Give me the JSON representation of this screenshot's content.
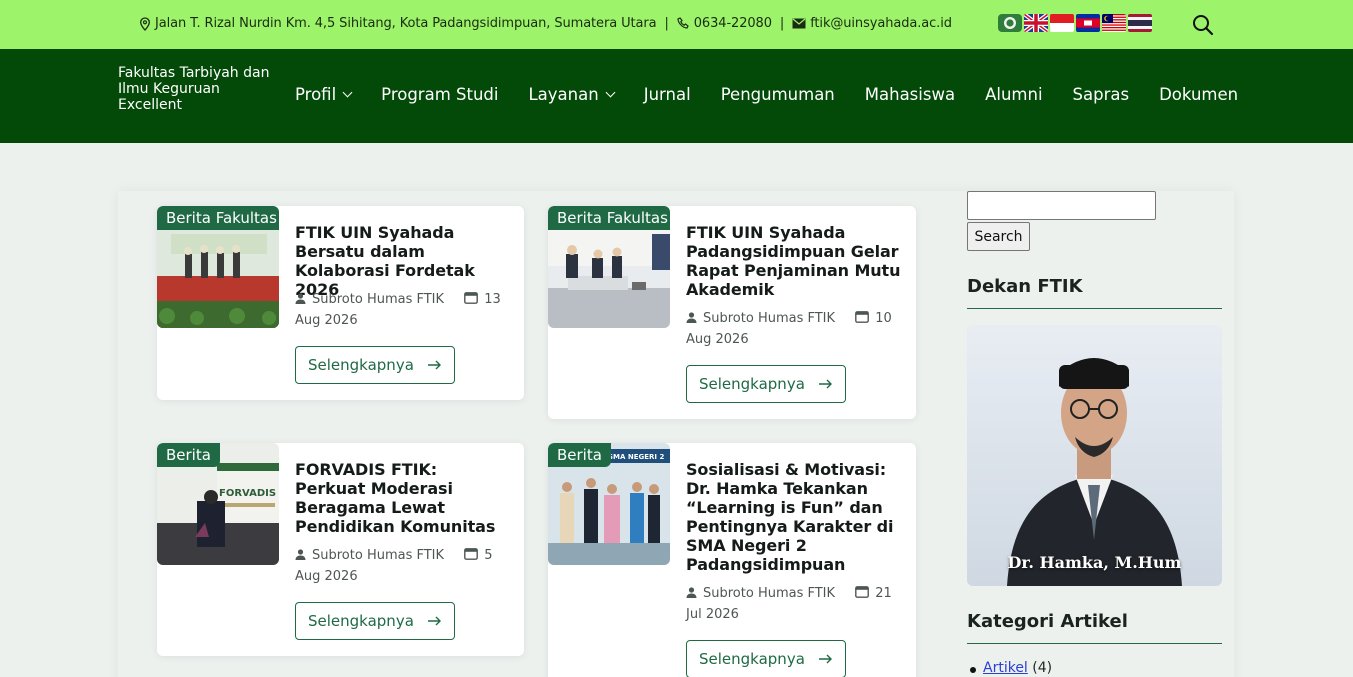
{
  "topbar": {
    "address": "Jalan T. Rizal Nurdin Km. 4,5 Sihitang, Kota Padangsidimpuan, Sumatera Utara",
    "phone": "0634-22080",
    "email": "ftik@uinsyahada.ac.id",
    "separator": "|",
    "flags": [
      "flag-institution",
      "flag-uk",
      "flag-indonesia",
      "flag-cambodia",
      "flag-malaysia",
      "flag-thailand"
    ],
    "bg_color": "#9df36a"
  },
  "navbar": {
    "brand_line1": "Fakultas Tarbiyah dan",
    "brand_line2": "Ilmu Keguruan",
    "brand_line3": "Excellent",
    "bg_color": "#034a08",
    "items": [
      {
        "label": "Profil",
        "dropdown": true
      },
      {
        "label": "Program Studi",
        "dropdown": false
      },
      {
        "label": "Layanan",
        "dropdown": true
      },
      {
        "label": "Jurnal",
        "dropdown": false
      },
      {
        "label": "Pengumuman",
        "dropdown": false
      },
      {
        "label": "Mahasiswa",
        "dropdown": false
      },
      {
        "label": "Alumni",
        "dropdown": false
      },
      {
        "label": "Sapras",
        "dropdown": false
      },
      {
        "label": "Dokumen",
        "dropdown": false
      }
    ]
  },
  "posts": [
    {
      "category": "Berita Fakultas",
      "title": "FTIK UIN Syahada Bersatu dalam Kolaborasi Fordetak 2026",
      "author": "Subroto Humas FTIK",
      "date": "13 Aug 2026",
      "button": "Selengkapnya"
    },
    {
      "category": "Berita Fakultas",
      "title": "FTIK UIN Syahada Padangsidimpuan Gelar Rapat Penjaminan Mutu Akademik",
      "author": "Subroto Humas FTIK",
      "date": "10 Aug 2026",
      "button": "Selengkapnya"
    },
    {
      "category": "Berita",
      "title": "FORVADIS FTIK: Perkuat Moderasi Beragama Lewat Pendidikan Komunitas",
      "author": "Subroto Humas FTIK",
      "date": "5 Aug 2026",
      "button": "Selengkapnya"
    },
    {
      "category": "Berita",
      "title": "Sosialisasi & Motivasi: Dr. Hamka Tekankan “Learning is Fun” dan Pentingnya Karakter di SMA Negeri 2 Padangsidimpuan",
      "author": "Subroto Humas FTIK",
      "date": "21 Jul 2026",
      "button": "Selengkapnya"
    }
  ],
  "thumb_texts": {
    "forvadis": "FORVADIS",
    "sma": "SMA NEGERI 2"
  },
  "sidebar": {
    "search_button": "Search",
    "search_value": "",
    "dean_title": "Dekan FTIK",
    "dean_name": "Dr. Hamka, M.Hum",
    "categories_title": "Kategori Artikel",
    "categories": [
      {
        "label": "Artikel",
        "count": "(4)"
      }
    ]
  },
  "colors": {
    "accent": "#1f6a45",
    "link": "#2a3fd6"
  }
}
